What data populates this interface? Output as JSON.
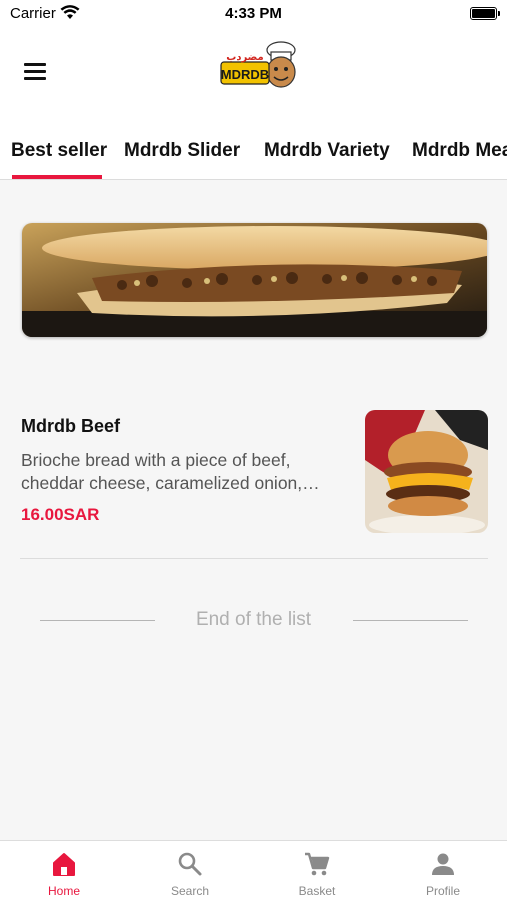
{
  "status_bar": {
    "carrier": "Carrier",
    "time": "4:33 PM"
  },
  "header": {
    "logo_text": "MDRDB",
    "logo_arabic": "مضردب"
  },
  "tabs": [
    {
      "label": "Best seller",
      "active": true
    },
    {
      "label": "Mdrdb Slider",
      "active": false
    },
    {
      "label": "Mdrdb Variety",
      "active": false
    },
    {
      "label": "Mdrdb Mea",
      "active": false
    }
  ],
  "products": [
    {
      "name": "Mdrdb Beef",
      "description": "Brioche bread with a piece of beef, cheddar cheese, caramelized onion,…",
      "price": "16.00SAR"
    }
  ],
  "list_end_text": "End of the list",
  "bottom_nav": [
    {
      "label": "Home",
      "icon": "home-icon",
      "active": true
    },
    {
      "label": "Search",
      "icon": "search-icon",
      "active": false
    },
    {
      "label": "Basket",
      "icon": "cart-icon",
      "active": false
    },
    {
      "label": "Profile",
      "icon": "person-icon",
      "active": false
    }
  ],
  "colors": {
    "accent": "#e8173e",
    "background": "#f6f6f6",
    "inactive_icon": "#8a8a8a"
  }
}
